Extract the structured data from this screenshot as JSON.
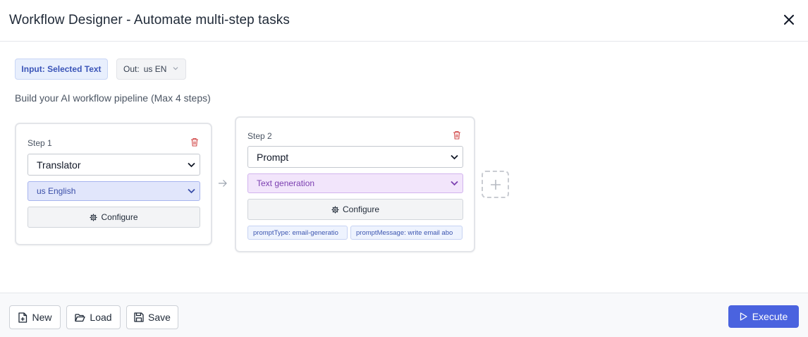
{
  "window": {
    "title": "Workflow Designer - Automate multi-step tasks"
  },
  "toolbar": {
    "input_chip": "Input: Selected Text",
    "output_label": "Out:",
    "output_value": "us EN"
  },
  "subtitle": "Build your AI workflow pipeline (Max 4 steps)",
  "steps": [
    {
      "label": "Step 1",
      "tool": "Translator",
      "option": "us English",
      "configure_label": "Configure",
      "params": []
    },
    {
      "label": "Step 2",
      "tool": "Prompt",
      "option": "Text generation",
      "configure_label": "Configure",
      "params": [
        "promptType: email-generatio",
        "promptMessage: write email abo"
      ]
    }
  ],
  "footer": {
    "new_label": "New",
    "load_label": "Load",
    "save_label": "Save",
    "execute_label": "Execute"
  },
  "colors": {
    "accent": "#4a63df",
    "trash": "#d24a4a",
    "input_chip_bg": "#e8effd",
    "language_select_bg": "#e1e6fb",
    "generation_select_bg": "#f2e5fb"
  },
  "icons": {
    "close": "close-icon",
    "trash": "trash-icon",
    "configure": "gear-icon",
    "arrow": "arrow-right-icon",
    "add": "plus-icon",
    "new": "file-plus-icon",
    "load": "folder-open-icon",
    "save": "save-icon",
    "execute": "play-icon"
  }
}
